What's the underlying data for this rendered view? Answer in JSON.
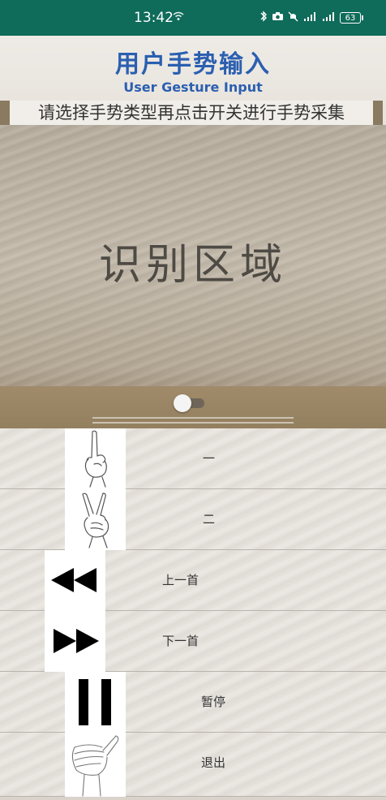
{
  "status_bar": {
    "time": "13:42",
    "battery": "63"
  },
  "header": {
    "title_cn": "用户手势输入",
    "title_en": "User Gesture Input",
    "instruction": "请选择手势类型再点击开关进行手势采集"
  },
  "camera": {
    "label": "识别区域",
    "switch_on": false
  },
  "gestures": [
    {
      "label": "一",
      "icon": "index-finger-hand-icon"
    },
    {
      "label": "二",
      "icon": "victory-hand-icon"
    },
    {
      "label": "上一首",
      "icon": "rewind-icon"
    },
    {
      "label": "下一首",
      "icon": "fast-forward-icon"
    },
    {
      "label": "暂停",
      "icon": "pause-icon"
    },
    {
      "label": "退出",
      "icon": "thumb-hand-icon"
    }
  ],
  "colors": {
    "status_bar": "#0f6b5a",
    "title": "#2b5fb0"
  }
}
